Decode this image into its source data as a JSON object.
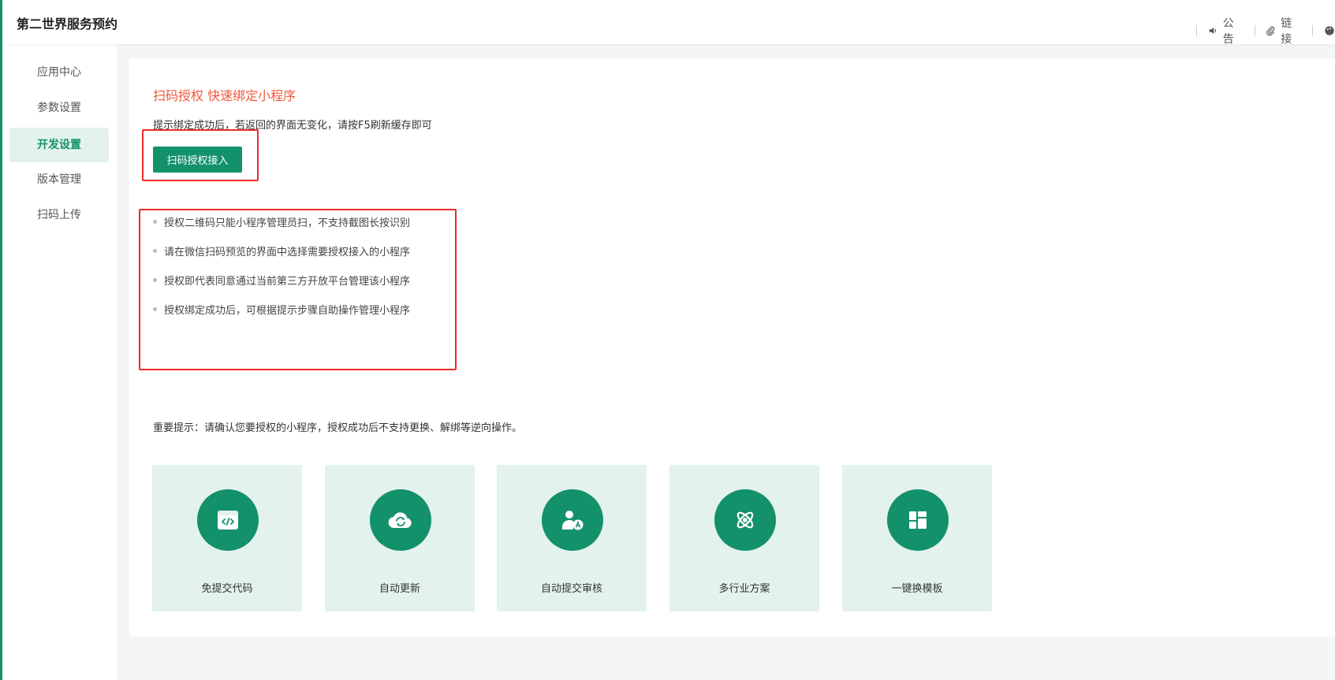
{
  "app": {
    "title": "第二世界服务预约"
  },
  "header": {
    "actions": [
      {
        "label": "公告",
        "icon": "speaker-icon"
      },
      {
        "label": "链接",
        "icon": "paperclip-icon"
      }
    ]
  },
  "sidebar": {
    "items": [
      {
        "label": "应用中心",
        "active": false
      },
      {
        "label": "参数设置",
        "active": false
      },
      {
        "label": "开发设置",
        "active": true
      },
      {
        "label": "版本管理",
        "active": false
      },
      {
        "label": "扫码上传",
        "active": false
      }
    ]
  },
  "main": {
    "heading": "扫码授权 快速绑定小程序",
    "tip": "提示绑定成功后，若返回的界面无变化，请按F5刷新缓存即可",
    "auth_button": "扫码授权接入",
    "notes": [
      "授权二维码只能小程序管理员扫，不支持截图长按识别",
      "请在微信扫码预览的界面中选择需要授权接入的小程序",
      "授权即代表同意通过当前第三方开放平台管理该小程序",
      "授权绑定成功后，可根据提示步骤自助操作管理小程序"
    ],
    "important": "重要提示：请确认您要授权的小程序，授权成功后不支持更换、解绑等逆向操作。",
    "features": [
      {
        "label": "免提交代码",
        "icon": "code-window-icon"
      },
      {
        "label": "自动更新",
        "icon": "cloud-sync-icon"
      },
      {
        "label": "自动提交审核",
        "icon": "user-review-icon"
      },
      {
        "label": "多行业方案",
        "icon": "atom-icon"
      },
      {
        "label": "一键换模板",
        "icon": "layout-template-icon"
      }
    ]
  },
  "colors": {
    "brand": "#13916a",
    "brand_light": "#e3f2ec",
    "accent_red": "#f4573a",
    "highlight_border": "#ee2a2a"
  }
}
